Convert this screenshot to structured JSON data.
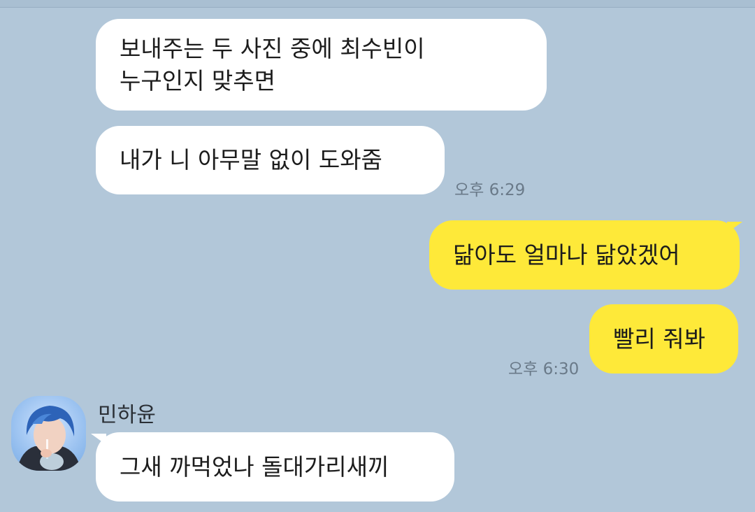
{
  "chat": {
    "messages": [
      {
        "lines": [
          "보내주는 두 사진 중에 최수빈이",
          "누구인지 맞추면"
        ]
      },
      {
        "lines": [
          "내가 니 아무말 없이 도와줌"
        ],
        "time": "오후 6:29"
      },
      {
        "lines": [
          "닮아도 얼마나 닮았겠어"
        ]
      },
      {
        "lines": [
          "빨리 줘봐"
        ],
        "time": "오후 6:30"
      },
      {
        "sender": "민하윤",
        "lines": [
          "그새 까먹었나 돌대가리새끼"
        ]
      }
    ]
  },
  "colors": {
    "background": "#b2c7d9",
    "incoming_bubble": "#ffffff",
    "outgoing_bubble": "#fee939",
    "timestamp": "#6a7a89"
  }
}
